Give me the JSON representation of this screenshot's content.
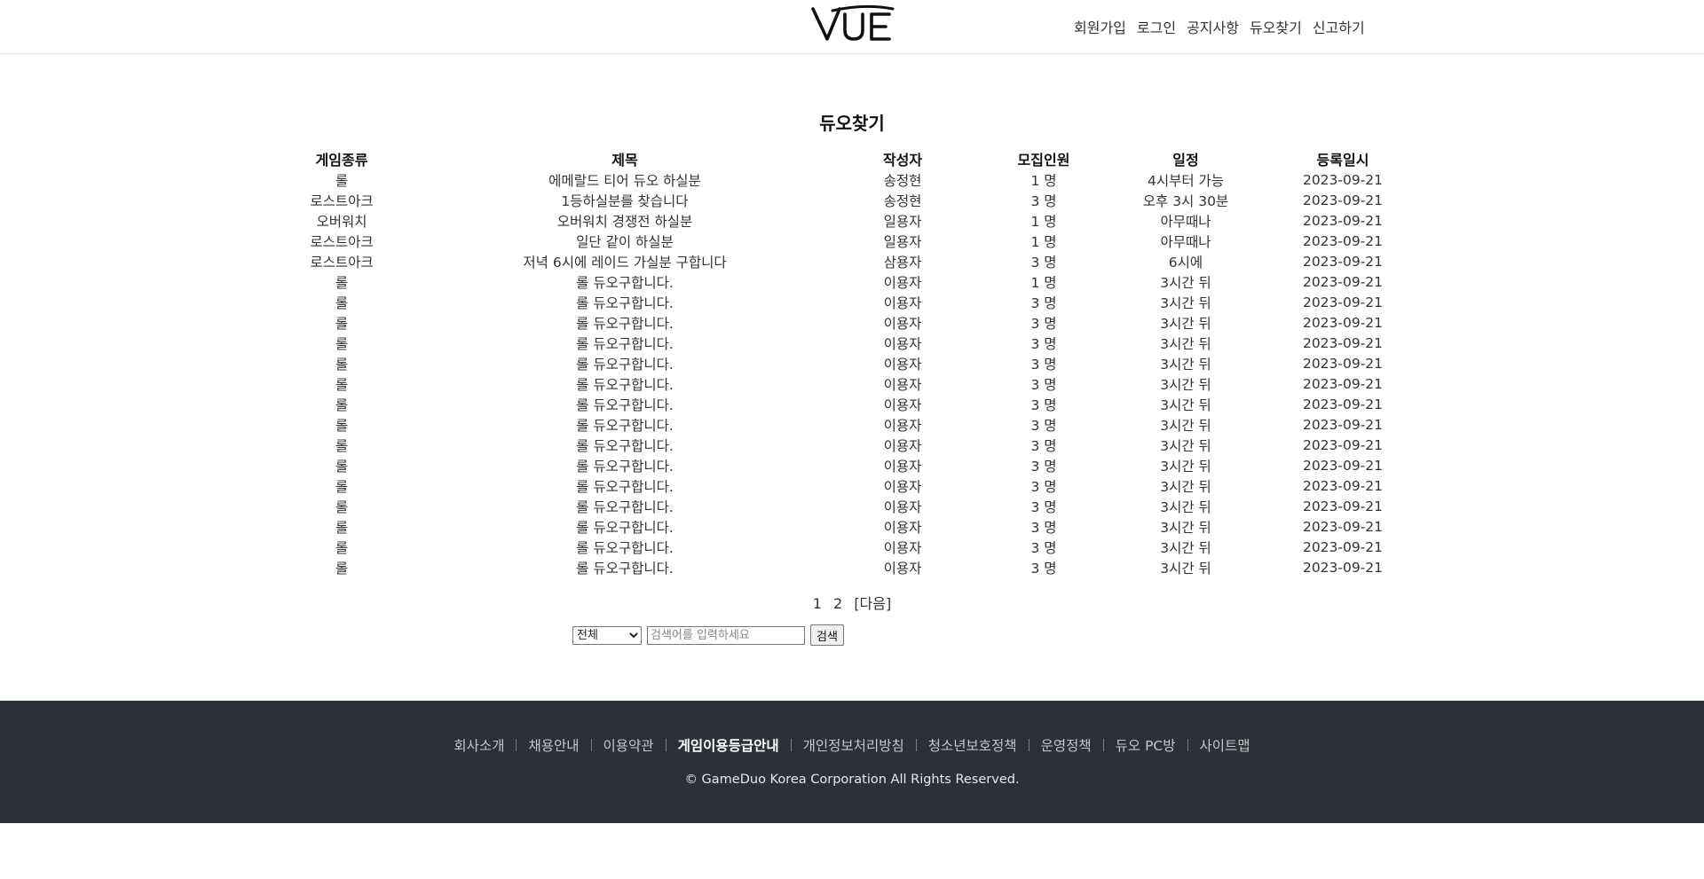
{
  "header": {
    "logo_text": "VUE",
    "nav": [
      "회원가입",
      "로그인",
      "공지사항",
      "듀오찾기",
      "신고하기"
    ]
  },
  "page_title": "듀오찾기",
  "table": {
    "headers": [
      "게임종류",
      "제목",
      "작성자",
      "모집인원",
      "일정",
      "등록일시"
    ],
    "rows": [
      [
        "롤",
        "에메랄드 티어 듀오 하실분",
        "송정현",
        "1 명",
        "4시부터 가능",
        "2023-09-21"
      ],
      [
        "로스트아크",
        "1등하실분를 찾습니다",
        "송정현",
        "3 명",
        "오후 3시 30분",
        "2023-09-21"
      ],
      [
        "오버워치",
        "오버워치 경쟁전 하실분",
        "일용자",
        "1 명",
        "아무때나",
        "2023-09-21"
      ],
      [
        "로스트아크",
        "일단 같이 하실분",
        "일용자",
        "1 명",
        "아무때나",
        "2023-09-21"
      ],
      [
        "로스트아크",
        "저녁 6시에 레이드 가실분 구합니다",
        "삼용자",
        "3 명",
        "6시에",
        "2023-09-21"
      ],
      [
        "롤",
        "롤 듀오구합니다.",
        "이용자",
        "1 명",
        "3시간 뒤",
        "2023-09-21"
      ],
      [
        "롤",
        "롤 듀오구합니다.",
        "이용자",
        "3 명",
        "3시간 뒤",
        "2023-09-21"
      ],
      [
        "롤",
        "롤 듀오구합니다.",
        "이용자",
        "3 명",
        "3시간 뒤",
        "2023-09-21"
      ],
      [
        "롤",
        "롤 듀오구합니다.",
        "이용자",
        "3 명",
        "3시간 뒤",
        "2023-09-21"
      ],
      [
        "롤",
        "롤 듀오구합니다.",
        "이용자",
        "3 명",
        "3시간 뒤",
        "2023-09-21"
      ],
      [
        "롤",
        "롤 듀오구합니다.",
        "이용자",
        "3 명",
        "3시간 뒤",
        "2023-09-21"
      ],
      [
        "롤",
        "롤 듀오구합니다.",
        "이용자",
        "3 명",
        "3시간 뒤",
        "2023-09-21"
      ],
      [
        "롤",
        "롤 듀오구합니다.",
        "이용자",
        "3 명",
        "3시간 뒤",
        "2023-09-21"
      ],
      [
        "롤",
        "롤 듀오구합니다.",
        "이용자",
        "3 명",
        "3시간 뒤",
        "2023-09-21"
      ],
      [
        "롤",
        "롤 듀오구합니다.",
        "이용자",
        "3 명",
        "3시간 뒤",
        "2023-09-21"
      ],
      [
        "롤",
        "롤 듀오구합니다.",
        "이용자",
        "3 명",
        "3시간 뒤",
        "2023-09-21"
      ],
      [
        "롤",
        "롤 듀오구합니다.",
        "이용자",
        "3 명",
        "3시간 뒤",
        "2023-09-21"
      ],
      [
        "롤",
        "롤 듀오구합니다.",
        "이용자",
        "3 명",
        "3시간 뒤",
        "2023-09-21"
      ],
      [
        "롤",
        "롤 듀오구합니다.",
        "이용자",
        "3 명",
        "3시간 뒤",
        "2023-09-21"
      ],
      [
        "롤",
        "롤 듀오구합니다.",
        "이용자",
        "3 명",
        "3시간 뒤",
        "2023-09-21"
      ]
    ]
  },
  "pagination": {
    "pages": [
      "1",
      "2"
    ],
    "next_label": "[다음]"
  },
  "search": {
    "select_value": "전체",
    "placeholder": "검색어를 입력하세요",
    "button_label": "검색"
  },
  "footer": {
    "links": [
      "회사소개",
      "채용안내",
      "이용약관",
      "게임이용등급안내",
      "개인정보처리방침",
      "청소년보호정책",
      "운영정책",
      "듀오 PC방",
      "사이트맵"
    ],
    "highlight_link": "게임이용등급안내",
    "copyright": "© GameDuo Korea Corporation All Rights Reserved."
  },
  "colors": {
    "footer_bg": "#2d3037",
    "text": "#333333"
  }
}
